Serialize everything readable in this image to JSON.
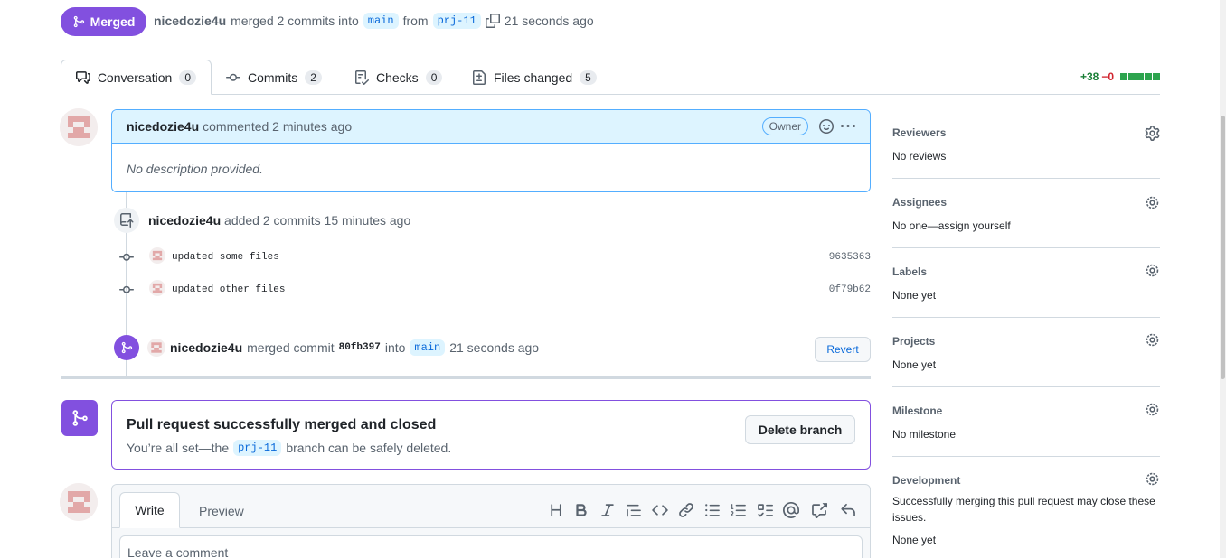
{
  "header": {
    "state_label": "Merged",
    "author": "nicedozie4u",
    "action_text": "merged 2 commits into",
    "base_branch": "main",
    "from_text": "from",
    "head_branch": "prj-11",
    "time_text": "21 seconds ago"
  },
  "tabs": [
    {
      "label": "Conversation",
      "count": "0",
      "icon": "conversation-icon"
    },
    {
      "label": "Commits",
      "count": "2",
      "icon": "commit-icon"
    },
    {
      "label": "Checks",
      "count": "0",
      "icon": "checklist-icon"
    },
    {
      "label": "Files changed",
      "count": "5",
      "icon": "file-diff-icon"
    }
  ],
  "diffstat": {
    "additions": "+38",
    "deletions": "−0",
    "filled_blocks_fraction": 1.0
  },
  "comment": {
    "author": "nicedozie4u",
    "meta": "commented 2 minutes ago",
    "badge": "Owner",
    "body": "No description provided."
  },
  "commits_event": {
    "author": "nicedozie4u",
    "text": "added 2 commits 15 minutes ago",
    "commits": [
      {
        "message": "updated some files",
        "sha": "9635363"
      },
      {
        "message": "updated other files",
        "sha": "0f79b62"
      }
    ]
  },
  "merge_event": {
    "author": "nicedozie4u",
    "text1": "merged commit",
    "commit": "80fb397",
    "text2": "into",
    "branch": "main",
    "time": "21 seconds ago",
    "revert_label": "Revert"
  },
  "merge_box": {
    "title": "Pull request successfully merged and closed",
    "desc_prefix": "You’re all set—the",
    "branch": "prj-11",
    "desc_suffix": "branch can be safely deleted.",
    "delete_label": "Delete branch"
  },
  "editor": {
    "tab_write": "Write",
    "tab_preview": "Preview",
    "placeholder": "Leave a comment"
  },
  "sidebar": {
    "reviewers": {
      "title": "Reviewers",
      "value": "No reviews"
    },
    "assignees": {
      "title": "Assignees",
      "value": "No one—assign yourself"
    },
    "labels": {
      "title": "Labels",
      "value": "None yet"
    },
    "projects": {
      "title": "Projects",
      "value": "None yet"
    },
    "milestone": {
      "title": "Milestone",
      "value": "No milestone"
    },
    "development": {
      "title": "Development",
      "desc": "Successfully merging this pull request may close these issues.",
      "value": "None yet"
    }
  },
  "colors": {
    "merged": "#8250df",
    "accent": "#0969da",
    "added": "#1a7f37",
    "deleted": "#d1242f"
  }
}
